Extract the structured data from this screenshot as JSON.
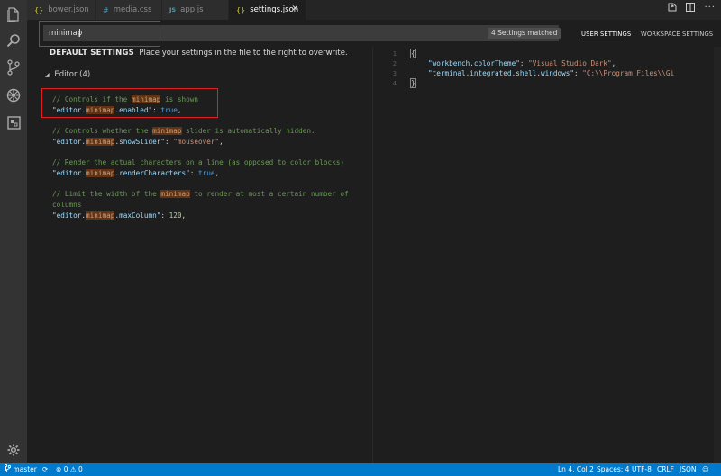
{
  "tabs": [
    {
      "icon": "{}",
      "label": "bower.json",
      "icon_color": "#cbcb41"
    },
    {
      "icon": "#",
      "label": "media.css",
      "icon_color": "#519aba"
    },
    {
      "icon": "JS",
      "label": "app.js",
      "icon_color": "#519aba"
    },
    {
      "icon": "{}",
      "label": "settings.json",
      "icon_color": "#cbcb41"
    }
  ],
  "search": {
    "value": "minimap",
    "match_count": "4 Settings matched"
  },
  "settings_tabs": {
    "user": "USER SETTINGS",
    "workspace": "WORKSPACE SETTINGS"
  },
  "default_settings": {
    "title": "DEFAULT SETTINGS",
    "subtitle": "Place your settings in the file to the right to overwrite.",
    "section": "Editor (4)"
  },
  "left_code": [
    {
      "comment_pre": "// Controls if the ",
      "comment_hl": "minimap",
      "comment_post": " is shown",
      "comment2": "",
      "key_pre": "\"editor.",
      "key_hl": "minimap",
      "key_post": ".enabled\"",
      "value": "true",
      "value_type": "kw"
    },
    {
      "comment_pre": "// Controls whether the ",
      "comment_hl": "minimap",
      "comment_post": " slider is automatically hidden.",
      "comment2": "",
      "key_pre": "\"editor.",
      "key_hl": "minimap",
      "key_post": ".showSlider\"",
      "value": "\"mouseover\"",
      "value_type": "str"
    },
    {
      "comment_pre": "// Render the actual characters on a line (as opposed to color blocks)",
      "comment_hl": "",
      "comment_post": "",
      "comment2": "",
      "key_pre": "\"editor.",
      "key_hl": "minimap",
      "key_post": ".renderCharacters\"",
      "value": "true",
      "value_type": "kw"
    },
    {
      "comment_pre": "// Limit the width of the ",
      "comment_hl": "minimap",
      "comment_post": " to render at most a certain number of",
      "comment2": "columns",
      "key_pre": "\"editor.",
      "key_hl": "minimap",
      "key_post": ".maxColumn\"",
      "value": "120",
      "value_type": "num"
    }
  ],
  "right_code": {
    "line_numbers": [
      "1",
      "2",
      "3",
      "4"
    ],
    "open": "{",
    "close": "}",
    "lines": [
      {
        "key": "\"workbench.colorTheme\"",
        "value": "\"Visual Studio Dark\"",
        "trail": ","
      },
      {
        "key": "\"terminal.integrated.shell.windows\"",
        "value": "\"C:\\\\Program Files\\\\Gi",
        "trail": ""
      }
    ]
  },
  "status": {
    "branch": "master",
    "errors": "0",
    "warnings": "0",
    "position": "Ln 4, Col 2",
    "spaces": "Spaces: 4",
    "encoding": "UTF-8",
    "eol": "CRLF",
    "language": "JSON"
  },
  "colors": {
    "accent": "#007acc",
    "highlight_box": "#e02020",
    "match_highlight": "#613214"
  }
}
